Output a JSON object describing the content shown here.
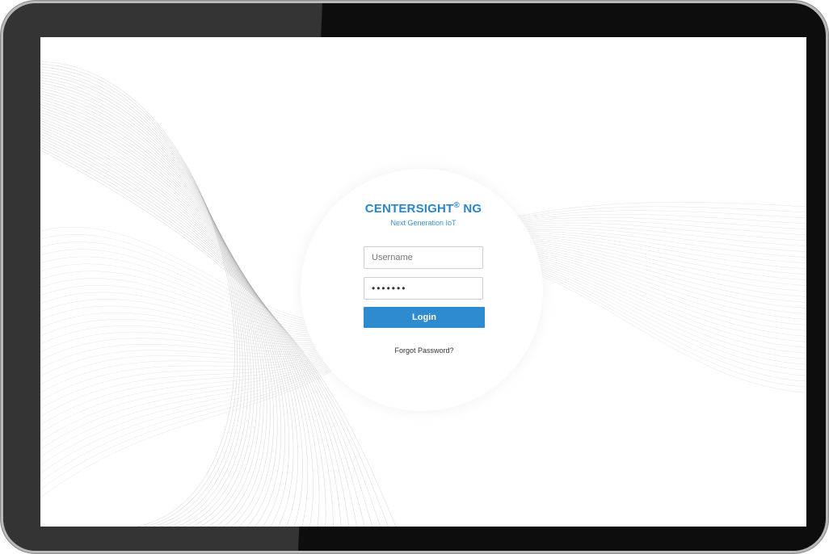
{
  "brand": {
    "name": "CENTERSIGHT",
    "registered": "®",
    "suffix": "NG",
    "tagline": "Next Generation IoT",
    "color": "#2a86c8"
  },
  "login_form": {
    "username_placeholder": "Username",
    "password_value": "•••••••",
    "login_label": "Login",
    "forgot_label": "Forgot Password?",
    "button_color": "#2e8bd0"
  }
}
